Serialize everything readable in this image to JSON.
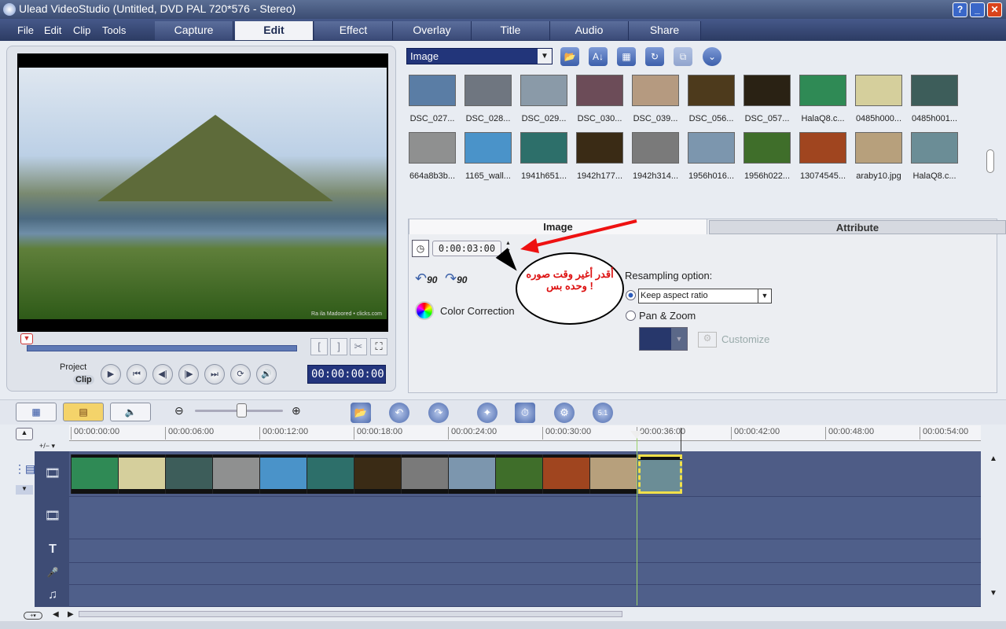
{
  "window": {
    "title": "Ulead VideoStudio (Untitled, DVD PAL 720*576 - Stereo)",
    "help": "?",
    "minimize": "_",
    "maximize": "□",
    "close": "✕"
  },
  "menu": [
    "File",
    "Edit",
    "Clip",
    "Tools"
  ],
  "tabs": [
    "Capture",
    "Edit",
    "Effect",
    "Overlay",
    "Title",
    "Audio",
    "Share"
  ],
  "active_tab": "Edit",
  "preview": {
    "watermark": "Ra ila Madoored • clicks.com",
    "labels": {
      "project": "Project",
      "clip": "Clip"
    },
    "timecode": "00:00:00:00",
    "mark_in": "[",
    "mark_out": "]",
    "cut": "✂",
    "enlarge": "⛶",
    "controls": {
      "play": "▶",
      "home": "⏮",
      "prev": "◀|",
      "next": "|▶",
      "end": "⏭",
      "repeat": "⟳",
      "volume": "🔊"
    }
  },
  "library": {
    "category": "Image",
    "tools": {
      "open": "📂",
      "sort": "A↓",
      "view": "▦",
      "refresh": "↻",
      "import": "⧉",
      "expand": "⌄"
    },
    "thumbs_row1": [
      {
        "label": "DSC_027...",
        "color": "#5a7da5"
      },
      {
        "label": "DSC_028...",
        "color": "#6f7680"
      },
      {
        "label": "DSC_029...",
        "color": "#8a9aa8"
      },
      {
        "label": "DSC_030...",
        "color": "#6c4c58"
      },
      {
        "label": "DSC_039...",
        "color": "#b59a80"
      },
      {
        "label": "DSC_056...",
        "color": "#4d3a1c"
      },
      {
        "label": "DSC_057...",
        "color": "#2a2214"
      },
      {
        "label": "HalaQ8.c...",
        "color": "#2f8a55"
      },
      {
        "label": "0485h000...",
        "color": "#d5cf9c"
      },
      {
        "label": "0485h001...",
        "color": "#3d5d5a"
      }
    ],
    "thumbs_row2": [
      {
        "label": "664a8b3b...",
        "color": "#8f9090"
      },
      {
        "label": "1165_wall...",
        "color": "#4a93c9"
      },
      {
        "label": "1941h651...",
        "color": "#2d6f6a"
      },
      {
        "label": "1942h177...",
        "color": "#3a2b15"
      },
      {
        "label": "1942h314...",
        "color": "#7a7a7a"
      },
      {
        "label": "1956h016...",
        "color": "#7c96ae"
      },
      {
        "label": "1956h022...",
        "color": "#3f6e2a"
      },
      {
        "label": "13074545...",
        "color": "#a0451f"
      },
      {
        "label": "araby10.jpg",
        "color": "#b7a07c"
      },
      {
        "label": "HalaQ8.c...",
        "color": "#6b8d96"
      }
    ]
  },
  "options": {
    "tab_image": "Image",
    "tab_attribute": "Attribute",
    "duration": "0:00:03:00",
    "rotate_left": "90",
    "rotate_right": "90",
    "color_correction": "Color Correction",
    "resampling_label": "Resampling option:",
    "keep_aspect": "Keep aspect ratio",
    "pan_zoom": "Pan & Zoom",
    "customize": "Customize",
    "annotation": "أقدر أغير وقت صوره وحده بس !",
    "clock": "◷",
    "up": "▲",
    "down": "▼",
    "dropdown": "▼"
  },
  "toolbar": {
    "zoom_out": "⊖",
    "zoom_in": "⊕",
    "fit": "⊠",
    "icons": {
      "storyboard": "▦",
      "timeline": "▤",
      "audio": "🔈",
      "insert": "📂",
      "undo": "↶",
      "redo": "↷",
      "enhance": "✦",
      "smart": "⏱",
      "batch": "⚙",
      "surround": "5.1"
    }
  },
  "timeline": {
    "ruler": [
      "00:00:00:00",
      "00:00:06:00",
      "00:00:12:00",
      "00:00:18:00",
      "00:00:24:00",
      "00:00:30:00",
      "00:00:36:00",
      "00:00:42:00",
      "00:00:48:00",
      "00:00:54:00"
    ],
    "track_icons": {
      "video": "🎞",
      "overlay": "🎞",
      "title": "T",
      "voice": "🎤",
      "music": "♫"
    },
    "track_menu": "+/− ▾",
    "clips": [
      "#2f8a55",
      "#d5cf9c",
      "#3d5d5a",
      "#8f9090",
      "#4a93c9",
      "#2d6f6a",
      "#3a2b15",
      "#7a7a7a",
      "#7c96ae",
      "#3f6e2a",
      "#a0451f",
      "#b7a07c",
      "#6b8d96"
    ]
  }
}
